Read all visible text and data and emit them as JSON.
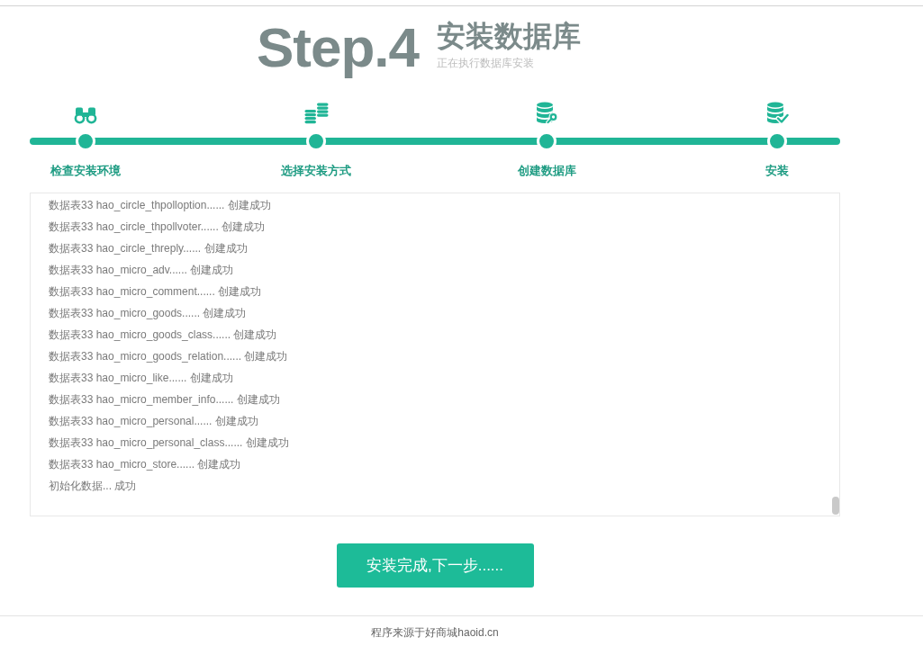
{
  "header": {
    "step": "Step.4",
    "title": "安装数据库",
    "subtitle": "正在执行数据库安装"
  },
  "steps": [
    {
      "label": "检查安装环境"
    },
    {
      "label": "选择安装方式"
    },
    {
      "label": "创建数据库"
    },
    {
      "label": "安装"
    }
  ],
  "log": {
    "lines": [
      "数据表33 hao_circle_thpolloption...... 创建成功",
      "数据表33 hao_circle_thpollvoter...... 创建成功",
      "数据表33 hao_circle_threply...... 创建成功",
      "数据表33 hao_micro_adv...... 创建成功",
      "数据表33 hao_micro_comment...... 创建成功",
      "数据表33 hao_micro_goods...... 创建成功",
      "数据表33 hao_micro_goods_class...... 创建成功",
      "数据表33 hao_micro_goods_relation...... 创建成功",
      "数据表33 hao_micro_like...... 创建成功",
      "数据表33 hao_micro_member_info...... 创建成功",
      "数据表33 hao_micro_personal...... 创建成功",
      "数据表33 hao_micro_personal_class...... 创建成功",
      "数据表33 hao_micro_store...... 创建成功",
      "初始化数据... 成功"
    ]
  },
  "button": {
    "label": "安装完成,下一步......"
  },
  "footer": {
    "text": "程序来源于好商城haoid.cn"
  }
}
